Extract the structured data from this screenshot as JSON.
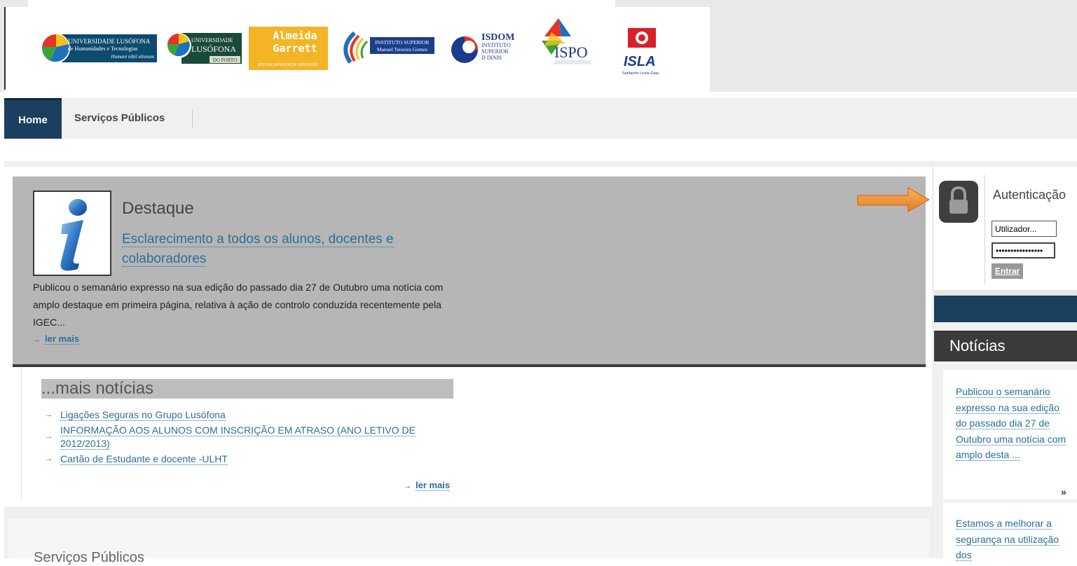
{
  "logos": [
    {
      "line1": "UNIVERSIDADE LUSÓFONA",
      "line2": "de Humanidades e Tecnologias",
      "line3": "Humani nihil alienum"
    },
    {
      "line1": "UNIVERSIDADE",
      "line2": "LUSÓFONA",
      "line3": "DO PORTO"
    },
    {
      "line1": "Almeida",
      "line2": "Garrett",
      "line3": "ESCOLA SUPERIOR DE EDUCAÇÃO"
    },
    {
      "line1": "INSTITUTO SUPERIOR",
      "line2": "Manuel Teixeira Gomes"
    },
    {
      "line1": "ISDOM",
      "line2": "INSTITUTO",
      "line3": "SUPERIOR",
      "line4": "D DINIS"
    },
    {
      "line1": "ISPO"
    },
    {
      "line1": "ISLA",
      "line2": "Santarém Leiria Gaia"
    }
  ],
  "nav": {
    "home": "Home",
    "servicos": "Serviços Públicos"
  },
  "destaque": {
    "title": "Destaque",
    "link": "Esclarecimento a todos os alunos, docentes e colaboradores",
    "text": "Publicou o semanário expresso na sua edição do passado dia 27 de Outubro uma notícia com amplo destaque em primeira página, relativa à ação de controlo conduzida recentemente pela IGEC...",
    "more_arrow": "→",
    "more": "ler mais"
  },
  "mais": {
    "title": "...mais notícias",
    "items": [
      "Ligações Seguras no Grupo Lusófona",
      "INFORMAÇÃO AOS ALUNOS COM INSCRIÇÃO EM ATRASO (ANO LETIVO DE 2012/2013)",
      "Cartão de Estudante e docente -ULHT"
    ],
    "arrow": "→",
    "more": "ler mais"
  },
  "bottom": {
    "title": "Serviços Públicos"
  },
  "auth": {
    "title": "Autenticação",
    "user_value": "Utilizador...",
    "password_value": "password12345678",
    "submit": "Entrar"
  },
  "noticias": {
    "title": "Notícias",
    "items": [
      "Publicou o semanário expresso na sua edição do passado dia 27 de Outubro uma notícia com amplo desta ...",
      "Estamos a melhorar a segurança na utilização dos"
    ],
    "more": "»"
  },
  "colors": {
    "nav_dark_blue": "#1b3f5e",
    "link_blue": "#2a6f9a",
    "featured_gray": "#b6b6b6",
    "arrow_orange": "#f0922e"
  },
  "icons": [
    "info-icon",
    "lock-icon",
    "arrow-right-icon",
    "orange-pointer-arrow"
  ]
}
